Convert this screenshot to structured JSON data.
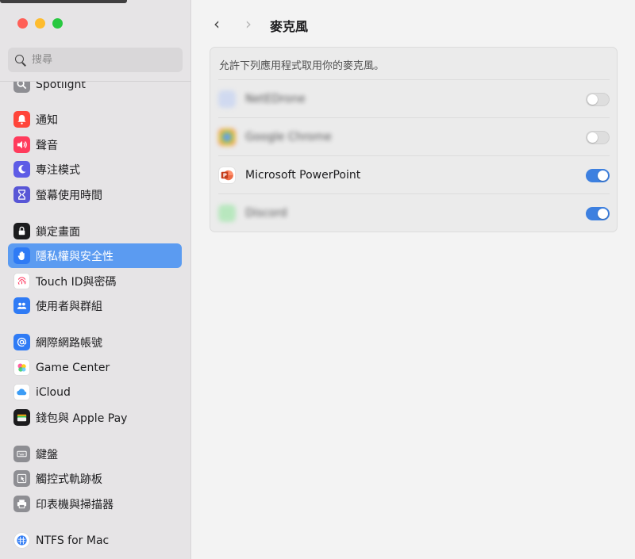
{
  "window": {
    "traffic_lights": [
      {
        "name": "close",
        "color": "#ff5f57"
      },
      {
        "name": "minimize",
        "color": "#febc2e"
      },
      {
        "name": "zoom",
        "color": "#28c840"
      }
    ]
  },
  "sidebar": {
    "search_placeholder": "搜尋",
    "items": [
      {
        "label": "Spotlight",
        "icon": "spotlight-icon",
        "color": "#8e8e93"
      },
      {
        "label": "通知",
        "icon": "bell-icon",
        "color": "#ff453a"
      },
      {
        "label": "聲音",
        "icon": "speaker-icon",
        "color": "#ff3b5c"
      },
      {
        "label": "專注模式",
        "icon": "moon-icon",
        "color": "#5e5ce6"
      },
      {
        "label": "螢幕使用時間",
        "icon": "hourglass-icon",
        "color": "#5856d6"
      },
      {
        "label": "鎖定畫面",
        "icon": "lock-icon",
        "color": "#1c1c1e"
      },
      {
        "label": "隱私權與安全性",
        "icon": "hand-icon",
        "color": "#2f7bf5",
        "active": true
      },
      {
        "label": "Touch ID與密碼",
        "icon": "fingerprint-icon",
        "color": "#ffffff"
      },
      {
        "label": "使用者與群組",
        "icon": "users-icon",
        "color": "#2f7bf5"
      },
      {
        "label": "網際網路帳號",
        "icon": "at-icon",
        "color": "#2f7bf5"
      },
      {
        "label": "Game Center",
        "icon": "game-center-icon",
        "color": "#ffffff"
      },
      {
        "label": "iCloud",
        "icon": "cloud-icon",
        "color": "#ffffff"
      },
      {
        "label": "錢包與 Apple Pay",
        "icon": "wallet-icon",
        "color": "#1c1c1e"
      },
      {
        "label": "鍵盤",
        "icon": "keyboard-icon",
        "color": "#8e8e93"
      },
      {
        "label": "觸控式軌跡板",
        "icon": "trackpad-icon",
        "color": "#8e8e93"
      },
      {
        "label": "印表機與掃描器",
        "icon": "printer-icon",
        "color": "#8e8e93"
      },
      {
        "label": "NTFS for Mac",
        "icon": "ntfs-icon",
        "color": "#ffffff"
      }
    ]
  },
  "main": {
    "back_glyph": "‹",
    "forward_glyph": "›",
    "title": "麥克風",
    "description": "允許下列應用程式取用你的麥克風。",
    "apps": [
      {
        "name": "NetEDrone",
        "enabled": false,
        "blurred": true,
        "icon_color": "#c7d4f2"
      },
      {
        "name": "Google Chrome",
        "enabled": false,
        "blurred": true,
        "icon_color": "#e8a35a"
      },
      {
        "name": "Microsoft PowerPoint",
        "enabled": true,
        "blurred": false,
        "icon_color": "#d24726"
      },
      {
        "name": "Discord",
        "enabled": true,
        "blurred": true,
        "icon_color": "#a8e6b0"
      }
    ]
  }
}
